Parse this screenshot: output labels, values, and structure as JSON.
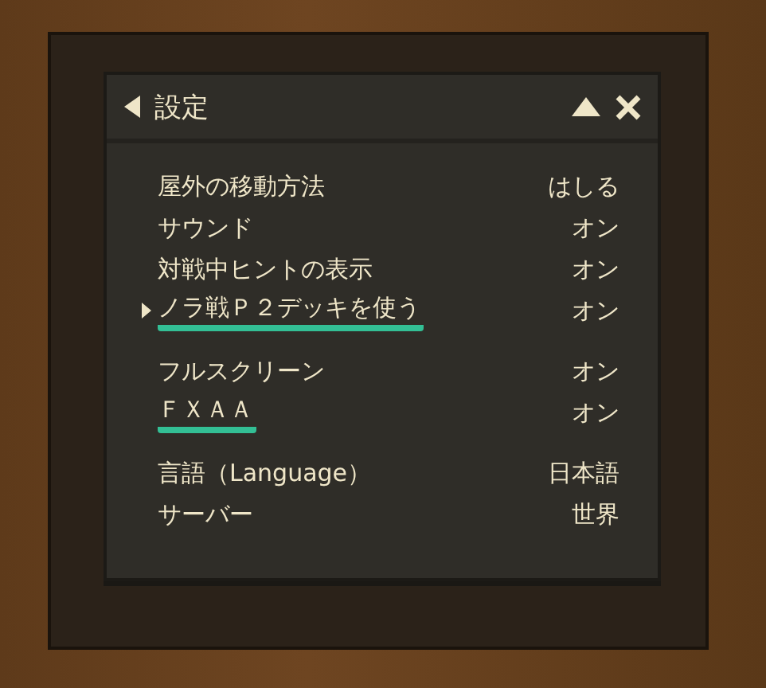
{
  "window": {
    "title": "設定"
  },
  "groups": [
    {
      "rows": [
        {
          "label": "屋外の移動方法",
          "value": "はしる",
          "selected": false,
          "underlined": false
        },
        {
          "label": "サウンド",
          "value": "オン",
          "selected": false,
          "underlined": false
        },
        {
          "label": "対戦中ヒントの表示",
          "value": "オン",
          "selected": false,
          "underlined": false
        },
        {
          "label": "ノラ戦Ｐ２デッキを使う",
          "value": "オン",
          "selected": true,
          "underlined": true
        }
      ]
    },
    {
      "rows": [
        {
          "label": "フルスクリーン",
          "value": "オン",
          "selected": false,
          "underlined": false
        },
        {
          "label": "ＦＸＡＡ",
          "value": "オン",
          "selected": false,
          "underlined": true
        }
      ]
    },
    {
      "rows": [
        {
          "label": "言語（Language）",
          "value": "日本語",
          "selected": false,
          "underlined": false
        },
        {
          "label": "サーバー",
          "value": "世界",
          "selected": false,
          "underlined": false
        }
      ]
    }
  ]
}
